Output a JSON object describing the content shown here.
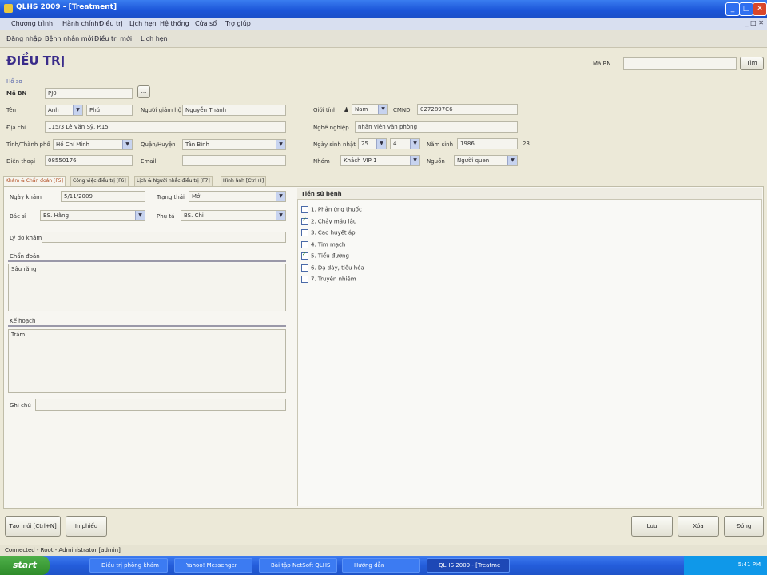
{
  "window": {
    "title": "QLHS 2009 - [Treatment]"
  },
  "menu": [
    "Chương trình",
    "Hành chính",
    "Điều trị",
    "Lịch hẹn",
    "Hệ thống",
    "Cửa sổ",
    "Trợ giúp"
  ],
  "toolbar": [
    "Đăng nhập",
    "Bệnh nhân mới",
    "Điều trị mới",
    "Lịch hẹn"
  ],
  "form": {
    "title": "ĐIỀU TRỊ",
    "search_label": "Mã BN",
    "search_value": "",
    "search_button": "Tìm",
    "section": "Hồ sơ",
    "ma_bn_label": "Mã BN",
    "ma_bn_value": "PJ0",
    "ten_label": "Tên",
    "ten_value": "Anh",
    "ten2_value": "Phú",
    "nguoi_giam_ho_label": "Người giám hộ",
    "nguoi_giam_ho_value": "Nguyễn Thành",
    "dia_chi_label": "Địa chỉ",
    "dia_chi_value": "115/3 Lê Văn Sỹ, P.15",
    "tinh_label": "Tỉnh/Thành phố",
    "tinh_value": "Hồ Chí Minh",
    "quan_label": "Quận/Huyện",
    "quan_value": "Tân Bình",
    "dien_thoai_label": "Điện thoại",
    "dien_thoai_value": "08550176",
    "email_label": "Email",
    "email_value": "",
    "gioi_tinh_label": "Giới tính",
    "gioi_tinh_value": "Nam",
    "cmnd_label": "CMND",
    "cmnd_value": "0272897C6",
    "nghe_nghiep_label": "Nghề nghiệp",
    "nghe_nghiep_value": "nhân viên văn phòng",
    "ngay_sinh_label": "Ngày sinh nhật",
    "ngay_sinh_day": "25",
    "ngay_sinh_month": "4",
    "nam_sinh_label": "Năm sinh",
    "nam_sinh_value": "1986",
    "nam_sinh_age": "23",
    "nhom_label": "Nhóm",
    "nhom_value": "Khách VIP 1",
    "nguon_label": "Nguồn",
    "nguon_value": "Người quen"
  },
  "tabs": [
    "Khám & Chẩn đoán [F5]",
    "Công việc điều trị [F6]",
    "Lịch & Người nhắc điều trị [F7]",
    "Hình ảnh [Ctrl+I]"
  ],
  "exam": {
    "ngay_kham_label": "Ngày khám",
    "ngay_kham_value": "5/11/2009",
    "trang_thai_label": "Trạng thái",
    "trang_thai_value": "Mới",
    "bac_si_label": "Bác sĩ",
    "bac_si_value": "BS. Hằng",
    "phu_ta_label": "Phụ tá",
    "phu_ta_value": "BS. Chi",
    "ly_do_label": "Lý do khám",
    "chan_doan_label": "Chẩn đoán",
    "chan_doan_value": "Sâu răng",
    "ke_hoach_label": "Kế hoạch",
    "ke_hoach_value": "Trám",
    "ghi_chu_label": "Ghi chú",
    "tien_su_title": "Tiền sử bệnh",
    "tien_su": [
      {
        "label": "1. Phản ứng thuốc",
        "checked": false
      },
      {
        "label": "2. Chảy máu lâu",
        "checked": true
      },
      {
        "label": "3. Cao huyết áp",
        "checked": false
      },
      {
        "label": "4. Tim mạch",
        "checked": false
      },
      {
        "label": "5. Tiểu đường",
        "checked": true
      },
      {
        "label": "6. Dạ dày, tiêu hóa",
        "checked": false
      },
      {
        "label": "7. Truyền nhiễm",
        "checked": false
      }
    ]
  },
  "buttons": {
    "tao_moi": "Tạo mới [Ctrl+N]",
    "in_phieu": "In phiếu",
    "luu": "Lưu",
    "xoa": "Xóa",
    "dong": "Đóng"
  },
  "status": {
    "text": "Connected - Root - Administrator [admin]"
  },
  "taskbar": {
    "start": "start",
    "items": [
      "Điều trị phòng khám",
      "Yahoo! Messenger",
      "Bài tập NetSoft QLHS",
      "Hướng dẫn",
      "QLHS 2009 - [Treatme"
    ],
    "clock": "5:41 PM"
  }
}
